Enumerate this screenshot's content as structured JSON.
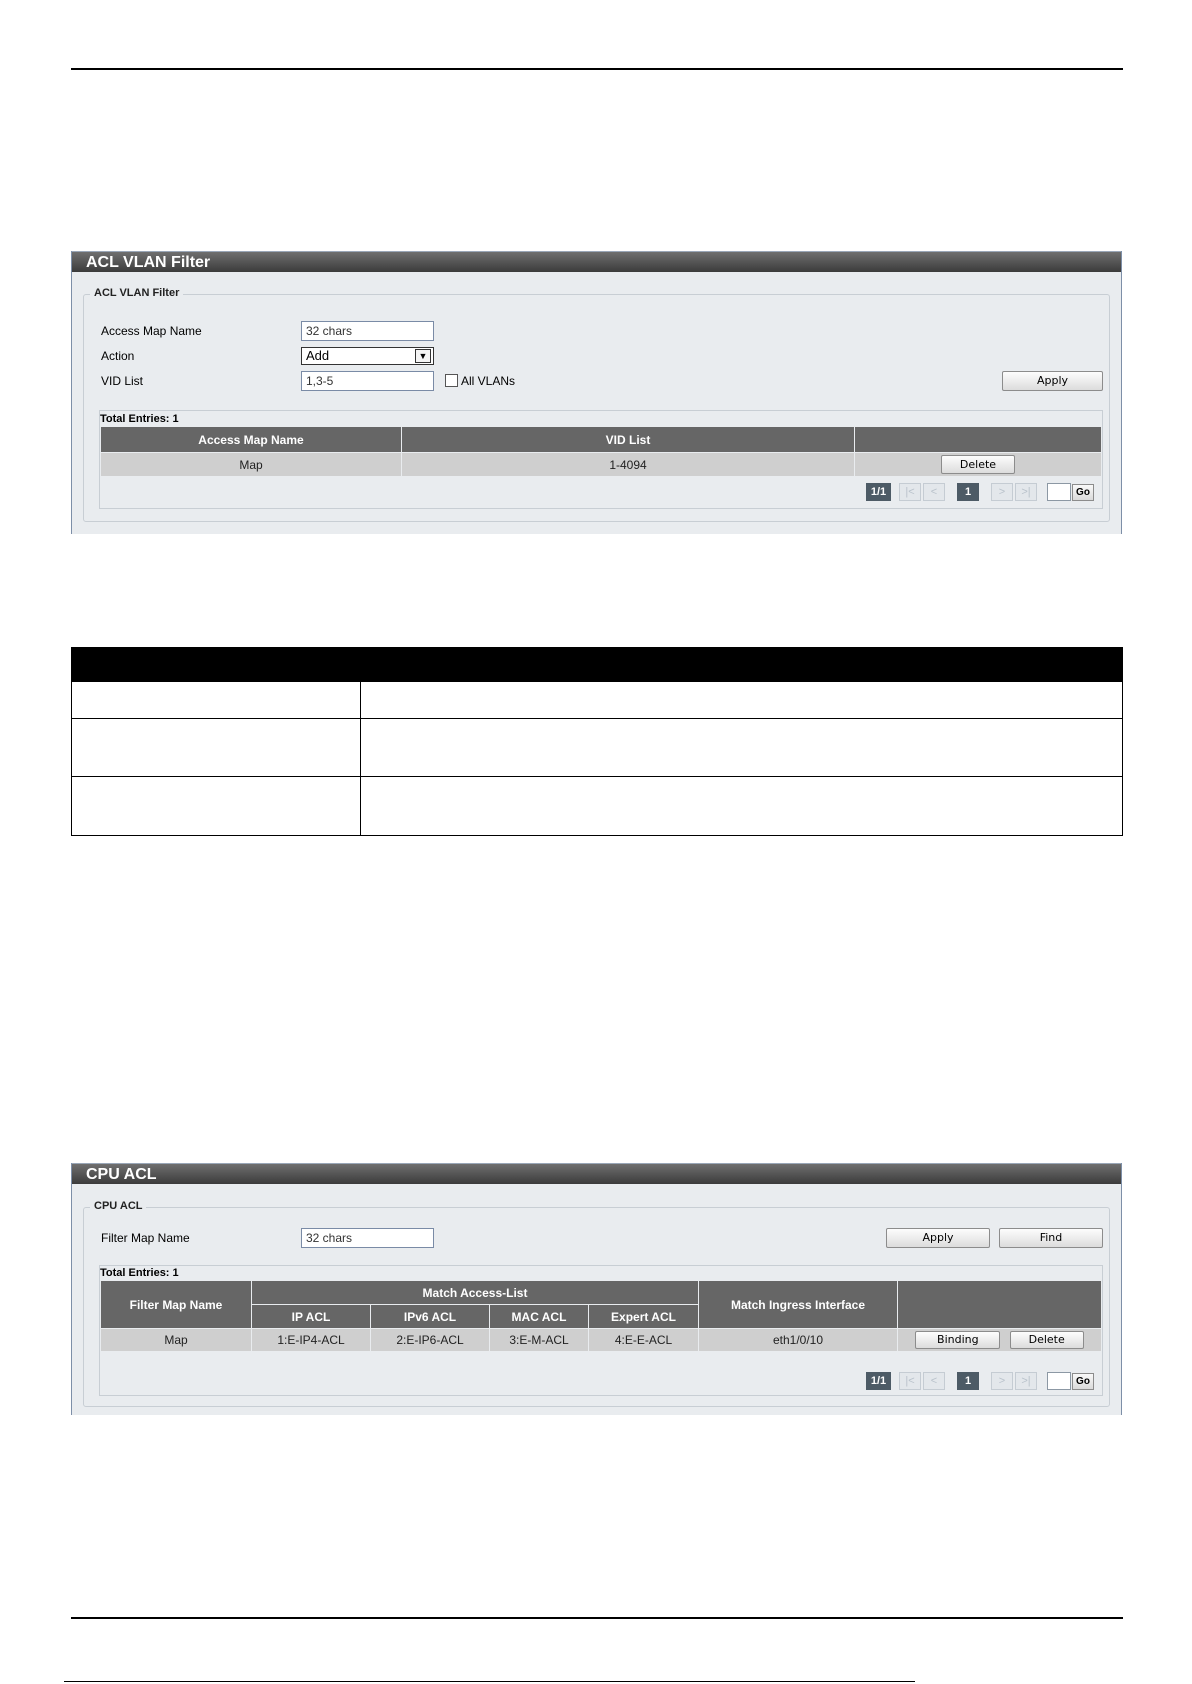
{
  "acl_vlan_filter": {
    "title": "ACL VLAN Filter",
    "legend": "ACL VLAN Filter",
    "access_map_name_label": "Access Map Name",
    "access_map_name_placeholder": "32 chars",
    "action_label": "Action",
    "action_value": "Add",
    "vid_list_label": "VID List",
    "vid_list_value": "1,3-5",
    "all_vlans_label": "All VLANs",
    "apply_label": "Apply",
    "total_entries": "Total Entries: 1",
    "columns": [
      "Access Map Name",
      "VID List",
      ""
    ],
    "rows": [
      {
        "access_map_name": "Map",
        "vid_list": "1-4094",
        "delete_label": "Delete"
      }
    ],
    "pager": {
      "page_info": "1/1",
      "first": "|<",
      "prev": "<",
      "current": "1",
      "next": ">",
      "last": ">|",
      "go": "Go"
    }
  },
  "cpu_acl": {
    "title": "CPU ACL",
    "legend": "CPU ACL",
    "filter_map_name_label": "Filter Map Name",
    "filter_map_name_placeholder": "32 chars",
    "apply_label": "Apply",
    "find_label": "Find",
    "total_entries": "Total Entries: 1",
    "header": {
      "filter_map_name": "Filter Map Name",
      "match_access_list": "Match Access-List",
      "ip_acl": "IP ACL",
      "ipv6_acl": "IPv6 ACL",
      "mac_acl": "MAC ACL",
      "expert_acl": "Expert ACL",
      "match_ingress_interface": "Match Ingress Interface"
    },
    "rows": [
      {
        "filter_map_name": "Map",
        "ip_acl": "1:E-IP4-ACL",
        "ipv6_acl": "2:E-IP6-ACL",
        "mac_acl": "3:E-M-ACL",
        "expert_acl": "4:E-E-ACL",
        "ingress": "eth1/0/10",
        "binding_label": "Binding",
        "delete_label": "Delete"
      }
    ],
    "pager": {
      "page_info": "1/1",
      "first": "|<",
      "prev": "<",
      "current": "1",
      "next": ">",
      "last": ">|",
      "go": "Go"
    }
  }
}
